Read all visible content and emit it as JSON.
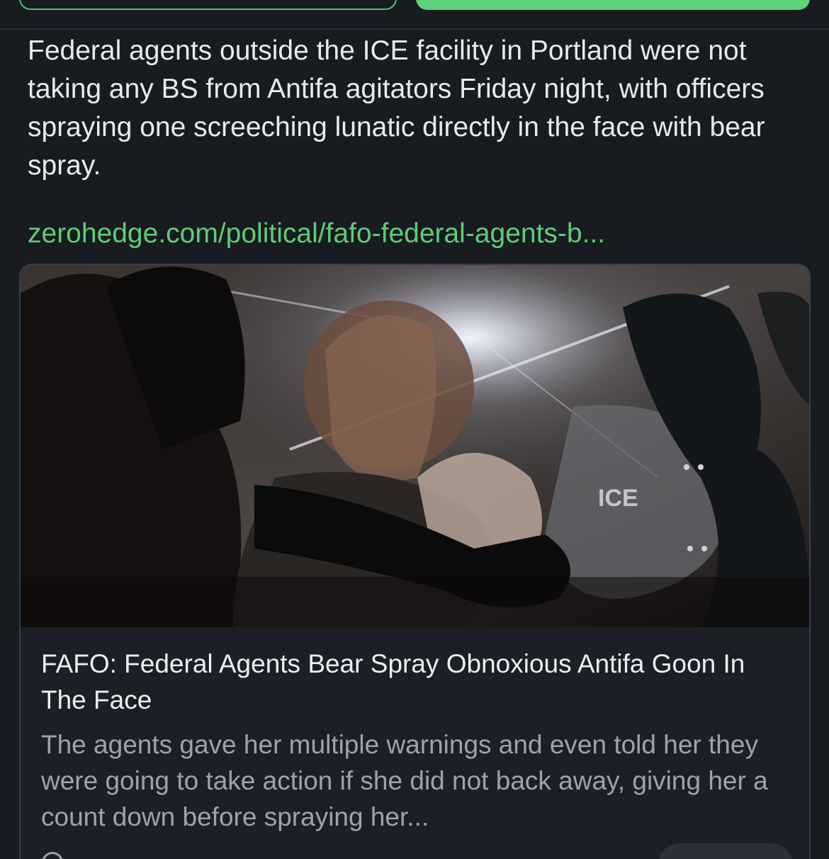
{
  "post": {
    "text": "Federal agents outside the ICE facility in Portland were not taking any BS from Antifa agitators Friday night, with officers spraying one screeching lunatic directly in the face with bear spray.",
    "link": "zerohedge.com/political/fafo-federal-agents-b..."
  },
  "card": {
    "image_label": "ICE",
    "title": "FAFO: Federal Agents Bear Spray Obnoxious Antifa Goon In The Face",
    "description": "The agents gave her multiple warnings and even told her they were going to take action if she did not back away, giving her a count down before spraying her..."
  },
  "colors": {
    "background": "#181b20",
    "accent": "#5ed27a",
    "link": "#5dcc78",
    "text_primary": "#e9eaec",
    "text_secondary": "#9ea3aa"
  }
}
